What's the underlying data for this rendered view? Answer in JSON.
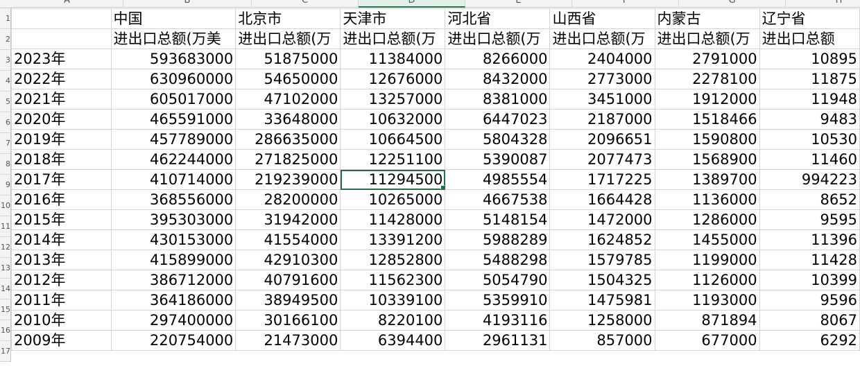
{
  "sheet": {
    "column_letters": [
      "A",
      "B",
      "C",
      "D",
      "E",
      "F",
      "G",
      "H"
    ],
    "active_column": "D",
    "row_numbers": [
      "1",
      "2",
      "3",
      "4",
      "5",
      "6",
      "7",
      "8",
      "9",
      "10",
      "11",
      "12",
      "13",
      "14",
      "15",
      "16",
      "17"
    ],
    "header_row": [
      "",
      "中国",
      "北京市",
      "天津市",
      "河北省",
      "山西省",
      "内蒙古",
      "辽宁省"
    ],
    "unit_row": [
      "",
      "进出口总额(万美",
      "进出口总额(万",
      "进出口总额(万",
      "进出口总额(万",
      "进出口总额(万",
      "进出口总额(万",
      "进出口总额"
    ],
    "data_rows": [
      [
        "2023年",
        "593683000",
        "51875000",
        "11384000",
        "8266000",
        "2404000",
        "2791000",
        "10895"
      ],
      [
        "2022年",
        "630960000",
        "54650000",
        "12676000",
        "8432000",
        "2773000",
        "2278100",
        "11875"
      ],
      [
        "2021年",
        "605017000",
        "47102000",
        "13257000",
        "8381000",
        "3451000",
        "1912000",
        "11948"
      ],
      [
        "2020年",
        "465591000",
        "33648000",
        "10632000",
        "6447023",
        "2187000",
        "1518466",
        "9483"
      ],
      [
        "2019年",
        "457789000",
        "286635000",
        "10664500",
        "5804328",
        "2096651",
        "1590800",
        "10530"
      ],
      [
        "2018年",
        "462244000",
        "271825000",
        "12251100",
        "5390087",
        "2077473",
        "1568900",
        "11460"
      ],
      [
        "2017年",
        "410714000",
        "219239000",
        "11294500",
        "4985554",
        "1717225",
        "1389700",
        "994223"
      ],
      [
        "2016年",
        "368556000",
        "28200000",
        "10265000",
        "4667538",
        "1664428",
        "1136000",
        "8652"
      ],
      [
        "2015年",
        "395303000",
        "31942000",
        "11428000",
        "5148154",
        "1472000",
        "1286000",
        "9595"
      ],
      [
        "2014年",
        "430153000",
        "41554000",
        "13391200",
        "5988289",
        "1624852",
        "1455000",
        "11396"
      ],
      [
        "2013年",
        "415899000",
        "42910300",
        "12852800",
        "5488298",
        "1579785",
        "1199000",
        "11428"
      ],
      [
        "2012年",
        "386712000",
        "40791600",
        "11562300",
        "5054790",
        "1504325",
        "1126000",
        "10399"
      ],
      [
        "2011年",
        "364186000",
        "38949500",
        "10339100",
        "5359910",
        "1475981",
        "1193000",
        "9596"
      ],
      [
        "2010年",
        "297400000",
        "30166100",
        "8220100",
        "4193116",
        "1258000",
        "871894",
        "8067"
      ],
      [
        "2009年",
        "220754000",
        "21473000",
        "6394400",
        "2961131",
        "857000",
        "677000",
        "6292"
      ]
    ],
    "selected_cell": {
      "row": 6,
      "col": 3
    }
  }
}
